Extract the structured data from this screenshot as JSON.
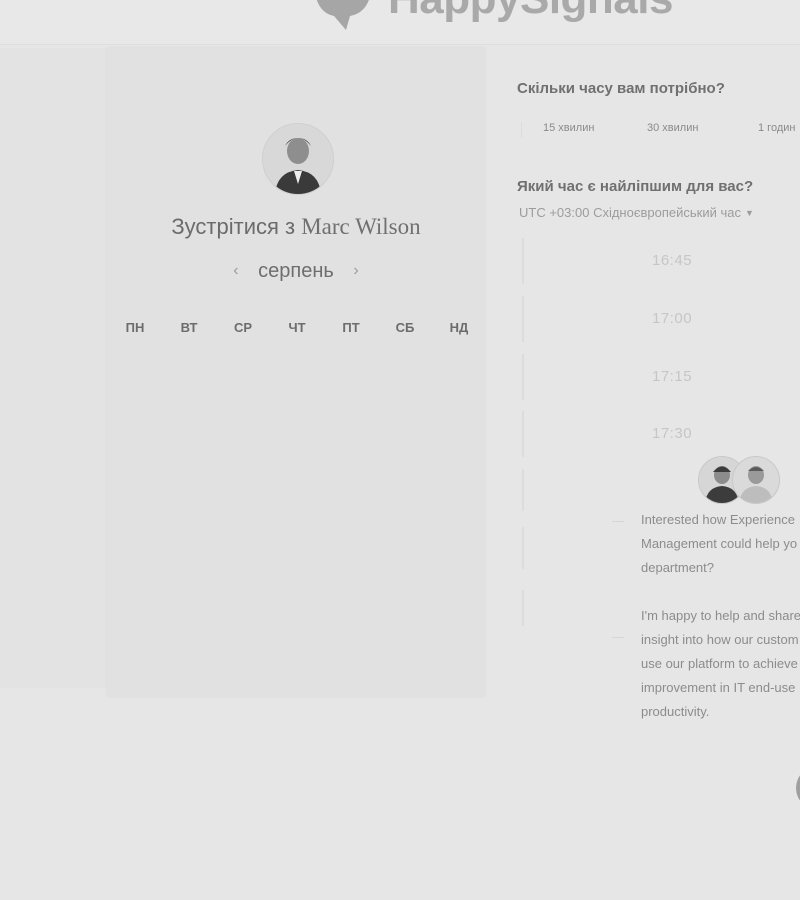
{
  "header": {
    "brand": "HappySignals"
  },
  "calendar": {
    "title_prefix": "Зустрітися з",
    "host_name": "Marc Wilson",
    "month": "серпень",
    "prev_icon": "chevron-left-icon",
    "next_icon": "chevron-right-icon",
    "weekdays": [
      "ПН",
      "ВТ",
      "СР",
      "ЧТ",
      "ПТ",
      "СБ",
      "НД"
    ]
  },
  "booking": {
    "duration_question": "Скільки часу вам потрібно?",
    "durations": [
      "15 хвилин",
      "30 хвилин",
      "1 годин"
    ],
    "time_question": "Який час є найліпшим для вас?",
    "timezone": "UTC +03:00 Східноєвропейський час",
    "slots": [
      "16:45",
      "17:00",
      "17:15",
      "17:30"
    ]
  },
  "chat": {
    "message_1": [
      "Interested how Experience",
      "Management could help yo",
      "department?"
    ],
    "message_2": [
      "I'm happy to help and share",
      "insight into how our custom",
      "use our platform to achieve",
      "improvement in IT end-use",
      "productivity."
    ]
  }
}
